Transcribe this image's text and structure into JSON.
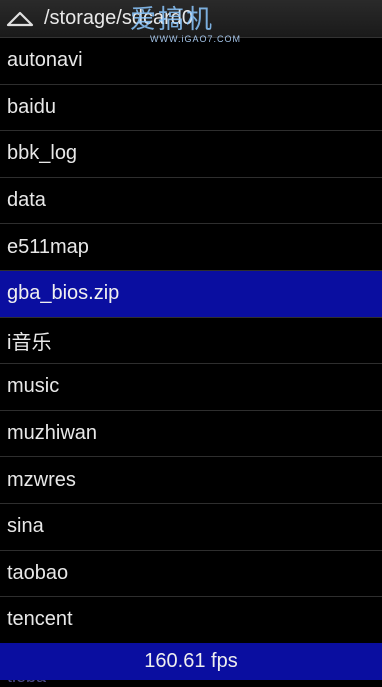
{
  "header": {
    "up_icon": "triangle-up-icon",
    "path": "/storage/sdcard0"
  },
  "watermark": {
    "text": "爱搞机",
    "url": "WWW.iGAO7.COM"
  },
  "files": [
    {
      "name": "autonavi",
      "selected": false
    },
    {
      "name": "baidu",
      "selected": false
    },
    {
      "name": "bbk_log",
      "selected": false
    },
    {
      "name": "data",
      "selected": false
    },
    {
      "name": "e511map",
      "selected": false
    },
    {
      "name": "gba_bios.zip",
      "selected": true
    },
    {
      "name": "i音乐",
      "selected": false
    },
    {
      "name": "music",
      "selected": false
    },
    {
      "name": "muzhiwan",
      "selected": false
    },
    {
      "name": "mzwres",
      "selected": false
    },
    {
      "name": "sina",
      "selected": false
    },
    {
      "name": "taobao",
      "selected": false
    },
    {
      "name": "tencent",
      "selected": false
    }
  ],
  "partial_item": "tieba",
  "status": {
    "fps": "160.61 fps"
  },
  "colors": {
    "selected_bg": "#0a0ea0",
    "background": "#000000",
    "text": "#e8e8e8"
  }
}
